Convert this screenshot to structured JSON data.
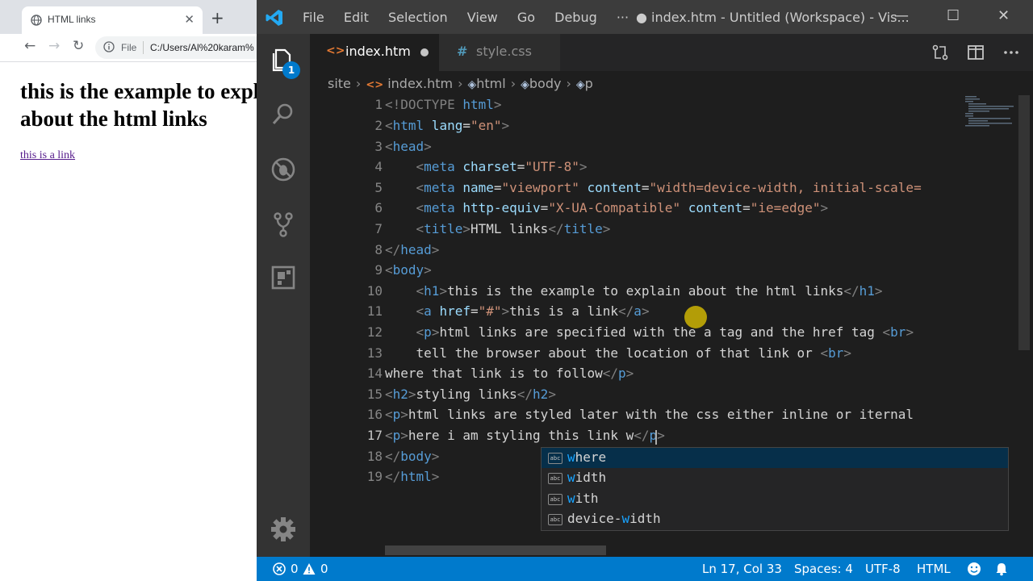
{
  "browser": {
    "tab_title": "HTML links",
    "tab_close": "✕",
    "new_tab": "+",
    "back": "←",
    "forward": "→",
    "reload": "↻",
    "address_scheme": "File",
    "address_url": "C:/Users/Al%20karam%",
    "page": {
      "heading": "this is the example to explain about the html links",
      "link_text": "this is a link"
    }
  },
  "vscode": {
    "menu": [
      "File",
      "Edit",
      "Selection",
      "View",
      "Go",
      "Debug",
      "···"
    ],
    "window_title": "● index.htm - Untitled (Workspace) - Vis...",
    "window_controls": {
      "minimize": "—",
      "maximize": "☐",
      "close": "✕"
    },
    "explorer_badge": "1",
    "tabs": [
      {
        "icon": "<>",
        "label": "index.htm",
        "dirty": true
      },
      {
        "icon": "#",
        "label": "style.css",
        "dirty": false
      }
    ],
    "breadcrumbs": [
      "site",
      "index.htm",
      "html",
      "body",
      "p"
    ],
    "line_numbers": [
      "1",
      "2",
      "3",
      "4",
      "5",
      "6",
      "7",
      "8",
      "9",
      "10",
      "11",
      "12",
      "13",
      "14",
      "15",
      "16",
      "17",
      "18",
      "19"
    ],
    "suggestions": [
      {
        "match": "w",
        "rest": "here"
      },
      {
        "match": "w",
        "rest": "idth"
      },
      {
        "match": "w",
        "rest": "ith"
      },
      {
        "prefix": "device-",
        "match": "w",
        "rest": "idth"
      }
    ],
    "suggest_kind_label": "abc",
    "status": {
      "errors": "0",
      "warnings": "0",
      "position": "Ln 17, Col 33",
      "spaces": "Spaces: 4",
      "encoding": "UTF-8",
      "language": "HTML"
    },
    "colors": {
      "accent": "#007acc",
      "tag": "#569cd6",
      "attribute": "#9cdcfe",
      "string": "#ce9178",
      "text": "#d4d4d4"
    }
  }
}
